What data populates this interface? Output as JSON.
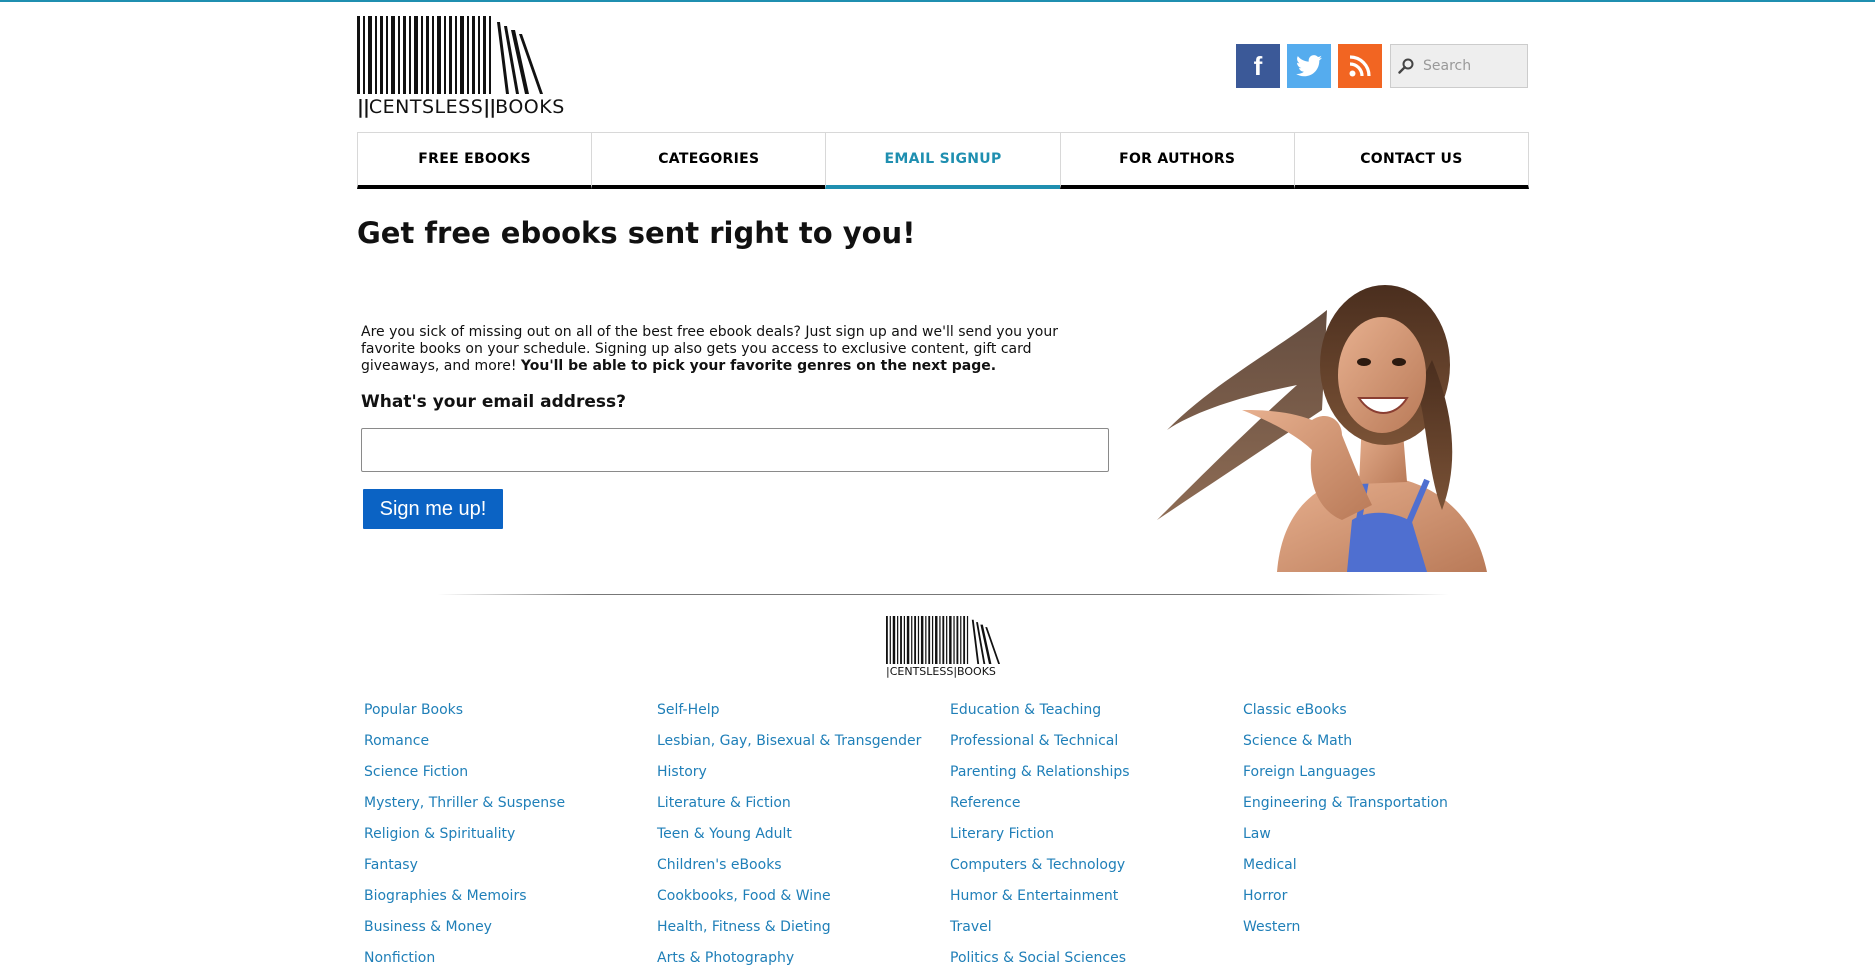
{
  "brand": {
    "name_left": "CENTSLESS",
    "name_right": "BOOKS"
  },
  "social": [
    {
      "name": "facebook-icon",
      "glyph": "f",
      "color": "#3b5998"
    },
    {
      "name": "twitter-icon",
      "glyph": "",
      "color": "#55acee"
    },
    {
      "name": "rss-icon",
      "glyph": "",
      "color": "#f26522"
    }
  ],
  "search": {
    "placeholder": "Search"
  },
  "nav": {
    "tabs": [
      {
        "label": "FREE EBOOKS",
        "active": false
      },
      {
        "label": "CATEGORIES",
        "active": false
      },
      {
        "label": "EMAIL SIGNUP",
        "active": true
      },
      {
        "label": "FOR AUTHORS",
        "active": false
      },
      {
        "label": "CONTACT US",
        "active": false
      }
    ]
  },
  "signup": {
    "headline": "Get free ebooks sent right to you!",
    "intro_text": "Are you sick of missing out on all of the best free ebook deals? Just sign up and we'll send you your favorite books on your schedule. Signing up also gets you access to exclusive content, gift card giveaways, and more! ",
    "intro_bold": "You'll be able to pick your favorite genres on the next page.",
    "email_label": "What's your email address?",
    "email_value": "",
    "button_label": "Sign me up!"
  },
  "footer": {
    "categories": [
      [
        "Popular Books",
        "Romance",
        "Science Fiction",
        "Mystery, Thriller & Suspense",
        "Religion & Spirituality",
        "Fantasy",
        "Biographies & Memoirs",
        "Business & Money",
        "Nonfiction"
      ],
      [
        "Self-Help",
        "Lesbian, Gay, Bisexual & Transgender",
        "History",
        "Literature & Fiction",
        "Teen & Young Adult",
        "Children's eBooks",
        "Cookbooks, Food & Wine",
        "Health, Fitness & Dieting",
        "Arts & Photography"
      ],
      [
        "Education & Teaching",
        "Professional & Technical",
        "Parenting & Relationships",
        "Reference",
        "Literary Fiction",
        "Computers & Technology",
        "Humor & Entertainment",
        "Travel",
        "Politics & Social Sciences"
      ],
      [
        "Classic eBooks",
        "Science & Math",
        "Foreign Languages",
        "Engineering & Transportation",
        "Law",
        "Medical",
        "Horror",
        "Western"
      ]
    ]
  },
  "colors": {
    "accent": "#1f8fb0",
    "link": "#1f7fb8",
    "button": "#0b63c4"
  }
}
